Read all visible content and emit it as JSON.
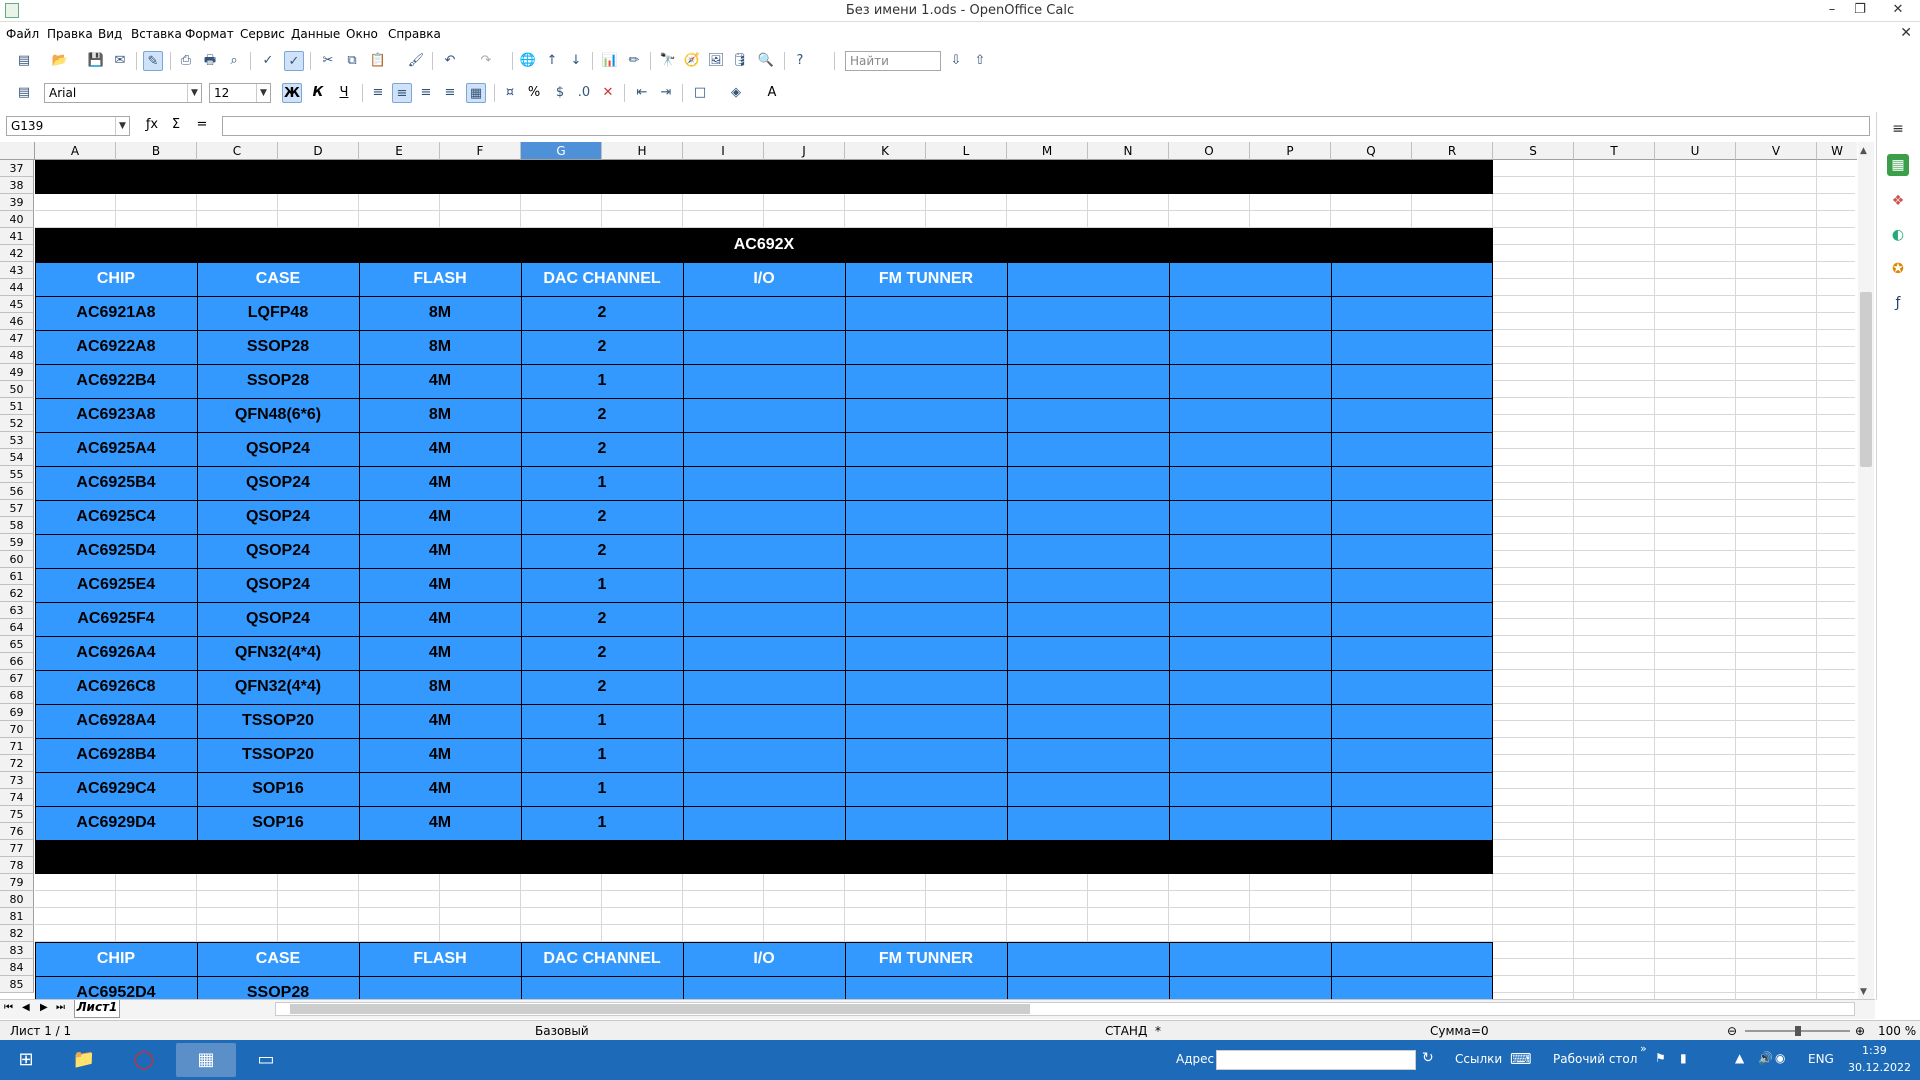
{
  "window": {
    "title": "Без имени 1.ods - OpenOffice Calc",
    "controls": {
      "minimize": "–",
      "maximize": "❐",
      "close": "✕"
    }
  },
  "menu": [
    "Файл",
    "Правка",
    "Вид",
    "Вставка",
    "Формат",
    "Сервис",
    "Данные",
    "Окно",
    "Справка"
  ],
  "toolbar": {
    "find_placeholder": "Найти",
    "font_name": "Arial",
    "font_size": "12",
    "bold_label": "Ж",
    "italic_label": "К",
    "underline_label": "Ч",
    "percent_label": "%"
  },
  "formula_bar": {
    "name_box": "G139",
    "formula": ""
  },
  "columns": [
    "A",
    "B",
    "C",
    "D",
    "E",
    "F",
    "G",
    "H",
    "I",
    "J",
    "K",
    "L",
    "M",
    "N",
    "O",
    "P",
    "Q",
    "R",
    "S",
    "T",
    "U",
    "V",
    "W"
  ],
  "selected_column": "G",
  "rows": [
    37,
    38,
    39,
    40,
    41,
    42,
    43,
    44,
    45,
    46,
    47,
    48,
    49,
    50,
    51,
    52,
    53,
    54,
    55,
    56,
    57,
    58,
    59,
    60,
    61,
    62,
    63,
    64,
    65,
    66,
    67,
    68,
    69,
    70,
    71,
    72,
    73,
    74,
    75,
    76,
    77,
    78,
    79,
    80,
    81,
    82,
    83,
    84,
    85
  ],
  "table1": {
    "title": "AC692X",
    "headers": [
      "CHIP",
      "CASE",
      "FLASH",
      "DAC CHANNEL",
      "I/O",
      "FM TUNNER",
      "",
      "",
      ""
    ],
    "rows": [
      [
        "AC6921A8",
        "LQFP48",
        "8M",
        "2"
      ],
      [
        "AC6922A8",
        "SSOP28",
        "8M",
        "2"
      ],
      [
        "AC6922B4",
        "SSOP28",
        "4M",
        "1"
      ],
      [
        "AC6923A8",
        "QFN48(6*6)",
        "8M",
        "2"
      ],
      [
        "AC6925A4",
        "QSOP24",
        "4M",
        "2"
      ],
      [
        "AC6925B4",
        "QSOP24",
        "4M",
        "1"
      ],
      [
        "AC6925C4",
        "QSOP24",
        "4M",
        "2"
      ],
      [
        "AC6925D4",
        "QSOP24",
        "4M",
        "2"
      ],
      [
        "AC6925E4",
        "QSOP24",
        "4M",
        "1"
      ],
      [
        "AC6925F4",
        "QSOP24",
        "4M",
        "2"
      ],
      [
        "AC6926A4",
        "QFN32(4*4)",
        "4M",
        "2"
      ],
      [
        "AC6926C8",
        "QFN32(4*4)",
        "8M",
        "2"
      ],
      [
        "AC6928A4",
        "TSSOP20",
        "4M",
        "1"
      ],
      [
        "AC6928B4",
        "TSSOP20",
        "4M",
        "1"
      ],
      [
        "AC6929C4",
        "SOP16",
        "4M",
        "1"
      ],
      [
        "AC6929D4",
        "SOP16",
        "4M",
        "1"
      ]
    ]
  },
  "table2": {
    "headers": [
      "CHIP",
      "CASE",
      "FLASH",
      "DAC CHANNEL",
      "I/O",
      "FM TUNNER"
    ],
    "first_row": [
      "AC6952D4",
      "SSOP28"
    ]
  },
  "sheet_tabs": [
    "Лист1"
  ],
  "status": {
    "page": "Лист 1 / 1",
    "style": "Базовый",
    "mode": "СТАНД",
    "modified": "*",
    "sum": "Сумма=0",
    "zoom": "100 %"
  },
  "taskbar": {
    "address_label": "Адрес",
    "links_label": "Ссылки",
    "desktop_label": "Рабочий стол",
    "lang": "ENG",
    "time": "1:39",
    "date": "30.12.2022"
  },
  "colors": {
    "table_blue": "#3399ff",
    "black_band": "#000000",
    "selected_header": "#4f91d9",
    "taskbar": "#1d6bb8"
  }
}
